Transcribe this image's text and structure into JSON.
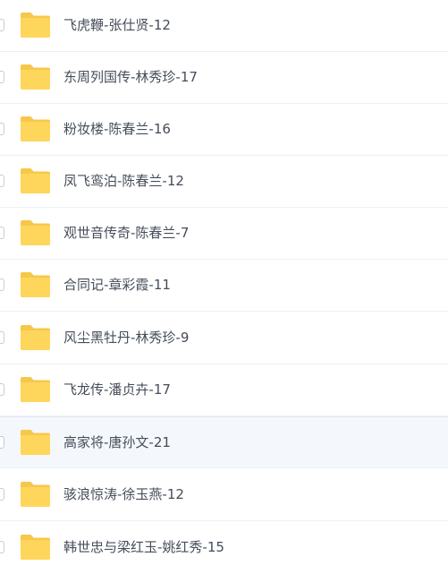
{
  "file_list": {
    "items": [
      {
        "name": "飞虎鞭-张仕贤-12",
        "type": "folder"
      },
      {
        "name": "东周列国传-林秀珍-17",
        "type": "folder"
      },
      {
        "name": "粉妆楼-陈春兰-16",
        "type": "folder"
      },
      {
        "name": "凤飞鸾泊-陈春兰-12",
        "type": "folder"
      },
      {
        "name": "观世音传奇-陈春兰-7",
        "type": "folder"
      },
      {
        "name": "合同记-章彩霞-11",
        "type": "folder"
      },
      {
        "name": "风尘黑牡丹-林秀珍-9",
        "type": "folder"
      },
      {
        "name": "飞龙传-潘贞卉-17",
        "type": "folder"
      },
      {
        "name": "高家将-唐孙文-21",
        "type": "folder",
        "hovered": true
      },
      {
        "name": "骇浪惊涛-徐玉燕-12",
        "type": "folder"
      },
      {
        "name": "韩世忠与梁红玉-姚红秀-15",
        "type": "folder"
      }
    ]
  },
  "colors": {
    "folder_back": "#f7c74a",
    "folder_front": "#ffd65c",
    "text": "#454d5a",
    "divider": "#eef0f4",
    "hover_background": "#f4f8fd"
  },
  "icons": {
    "folder": "folder-icon"
  }
}
